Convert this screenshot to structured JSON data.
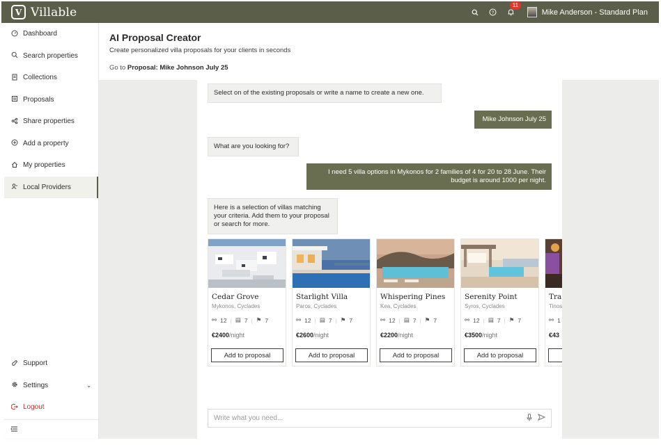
{
  "brand": {
    "logo_letter": "V",
    "name": "Villable"
  },
  "topbar": {
    "icons": [
      "search-icon",
      "help-icon",
      "bell-icon"
    ],
    "notification_count": "11",
    "user_label": "Mike Anderson - Standard Plan"
  },
  "sidebar": {
    "items": [
      {
        "label": "Dashboard",
        "icon": "dashboard-icon"
      },
      {
        "label": "Search properties",
        "icon": "search-icon"
      },
      {
        "label": "Collections",
        "icon": "collections-icon"
      },
      {
        "label": "Proposals",
        "icon": "proposals-icon"
      },
      {
        "label": "Share properties",
        "icon": "share-icon"
      },
      {
        "label": "Add a property",
        "icon": "add-circle-icon"
      },
      {
        "label": "My properties",
        "icon": "home-icon"
      },
      {
        "label": "Local Providers",
        "icon": "providers-icon",
        "active": true
      }
    ],
    "bottom_items": [
      {
        "label": "Support",
        "icon": "support-icon"
      },
      {
        "label": "Settings",
        "icon": "gear-icon"
      },
      {
        "label": "Logout",
        "icon": "logout-icon"
      }
    ]
  },
  "header": {
    "title": "AI Proposal Creator",
    "subtitle": "Create personalized villa proposals for your clients in seconds",
    "goto_prefix": "Go to",
    "goto_link": "Proposal: Mike Johnson July 25"
  },
  "chat": {
    "messages": [
      {
        "from": "bot",
        "text": "Select on of the existing proposals or write a name to create a new one."
      },
      {
        "from": "user",
        "text": "Mike Johnson July 25"
      },
      {
        "from": "bot",
        "text": "What are you looking for?"
      },
      {
        "from": "user",
        "text": "I need 5 villa options in Mykonos for 2 families of 4 for 20 to 28 June. Their budget is around 1000 per night."
      },
      {
        "from": "bot",
        "text": "Here is a selection of villas matching your criteria. Add them to your proposal or search for more."
      }
    ],
    "input_placeholder": "Write what you need..."
  },
  "villas": [
    {
      "name": "Cedar Grove",
      "location": "Mykonos, Cyclades",
      "guests": "12",
      "bedrooms": "7",
      "bathrooms": "7",
      "price": "€2400",
      "per": "/night",
      "button": "Add to proposal"
    },
    {
      "name": "Starlight Villa",
      "location": "Paros, Cyclades",
      "guests": "12",
      "bedrooms": "7",
      "bathrooms": "7",
      "price": "€2600",
      "per": "/night",
      "button": "Add to proposal"
    },
    {
      "name": "Whispering Pines",
      "location": "Kea, Cyclades",
      "guests": "12",
      "bedrooms": "7",
      "bathrooms": "7",
      "price": "€2200",
      "per": "/night",
      "button": "Add to proposal"
    },
    {
      "name": "Serenity Point",
      "location": "Syros, Cyclades",
      "guests": "12",
      "bedrooms": "7",
      "bathrooms": "7",
      "price": "€3500",
      "per": "/night",
      "button": "Add to proposal"
    },
    {
      "name": "Tra",
      "location": "Tinos",
      "guests": "1",
      "bedrooms": "",
      "bathrooms": "",
      "price": "€43",
      "per": "",
      "button": "A"
    }
  ],
  "colors": {
    "brand": "#5b5e48",
    "user_bubble": "#6a6e51",
    "logout": "#b9342c",
    "badge": "#e0352b"
  }
}
